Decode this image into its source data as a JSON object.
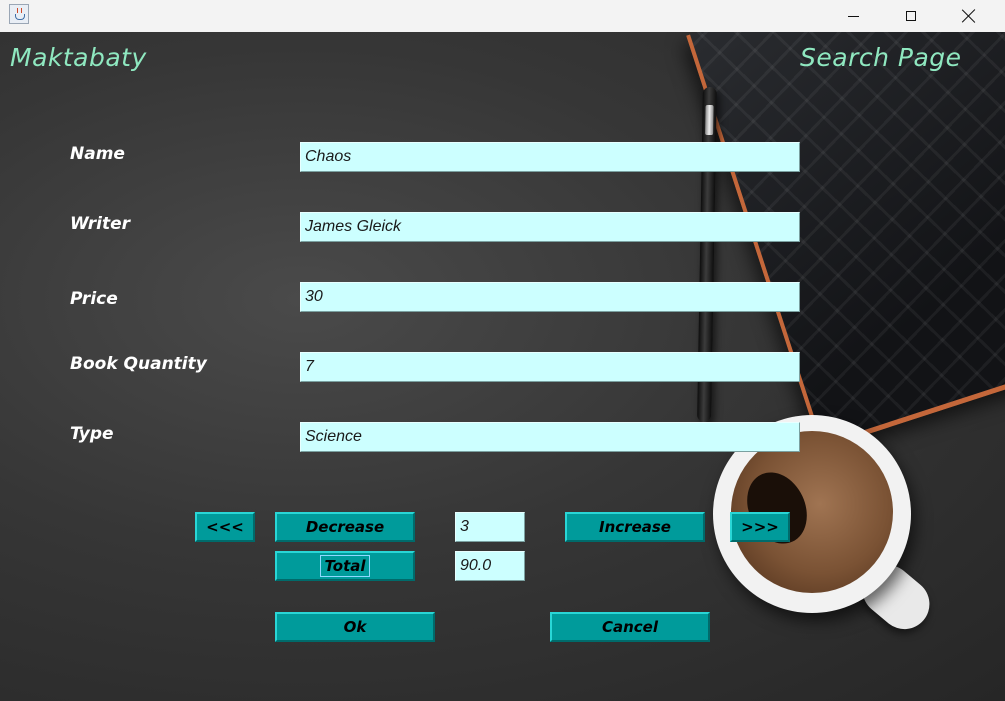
{
  "window": {
    "app_icon": "java-coffee-cup-icon",
    "controls": [
      "minimize-icon",
      "maximize-icon",
      "close-icon"
    ]
  },
  "header": {
    "app_title": "Maktabaty",
    "page_title": "Search Page"
  },
  "form": {
    "name": {
      "label": "Name",
      "value": "Chaos"
    },
    "writer": {
      "label": "Writer",
      "value": "James Gleick"
    },
    "price": {
      "label": "Price",
      "value": "30"
    },
    "quantity": {
      "label": "Book Quantity",
      "value": "7"
    },
    "type": {
      "label": "Type",
      "value": "Science"
    }
  },
  "controls": {
    "prev_label": "<<<",
    "next_label": ">>>",
    "decrease_label": "Decrease",
    "increase_label": "Increase",
    "count_value": "3",
    "total_label": "Total",
    "total_value": "90.0",
    "ok_label": "Ok",
    "cancel_label": "Cancel"
  },
  "colors": {
    "accent_teal": "#009b9b",
    "input_bg": "#ccffff",
    "title_green": "#8fe8c0"
  }
}
